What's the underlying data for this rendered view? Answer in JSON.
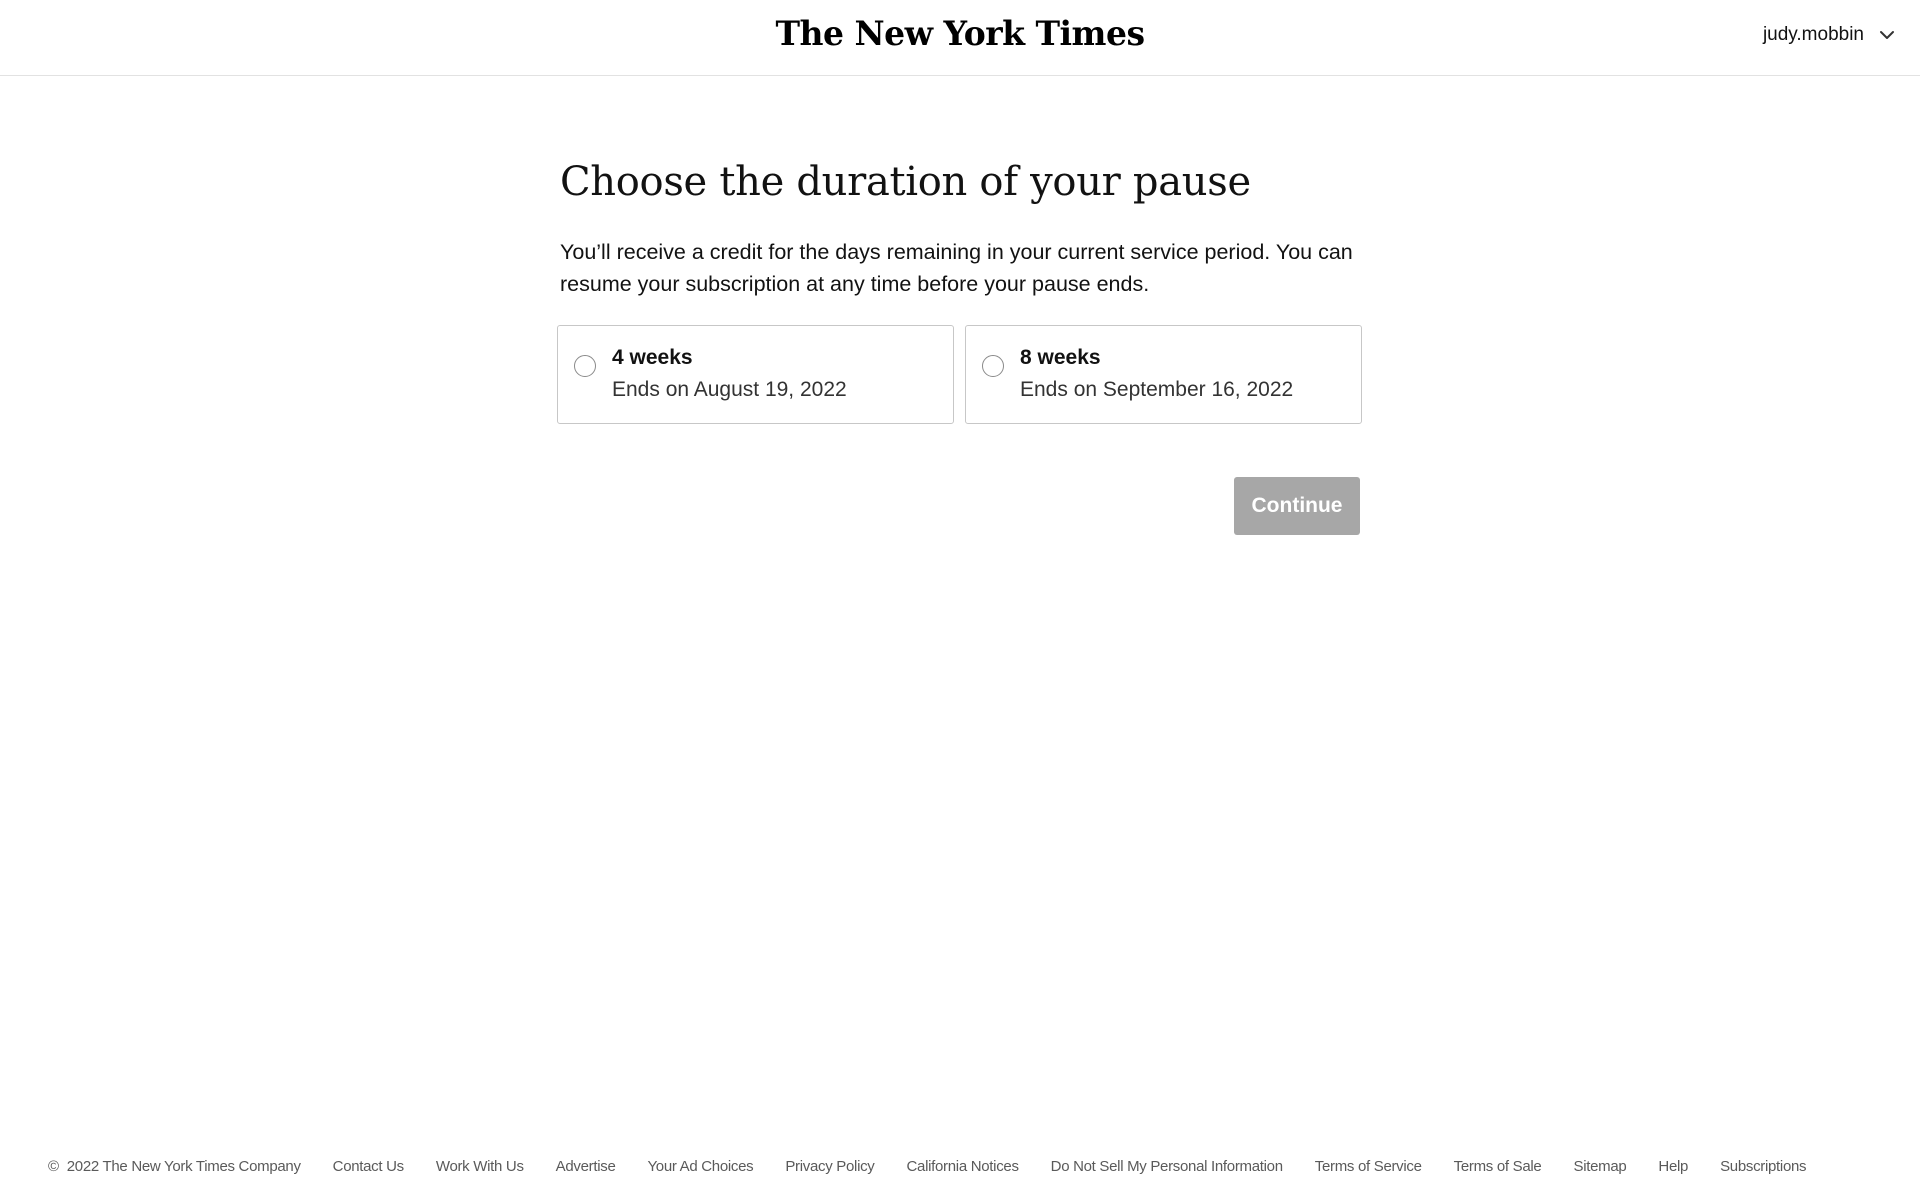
{
  "header": {
    "logo_text": "The New York Times",
    "account_name": "judy.mobbin",
    "account_icon": "chevron-down-icon"
  },
  "main": {
    "title": "Choose the duration of your pause",
    "description": "You’ll receive a credit for the days remaining in your current service period. You can resume your subscription at any time before your pause ends.",
    "options": [
      {
        "title": "4 weeks",
        "subtitle": "Ends on August 19, 2022",
        "selected": false
      },
      {
        "title": "8 weeks",
        "subtitle": "Ends on September 16, 2022",
        "selected": false
      }
    ],
    "continue_label": "Continue",
    "continue_color": "#a7a7a7"
  },
  "footer": {
    "copyright_symbol": "©",
    "copyright_text": "2022 The New York Times Company",
    "links": [
      "Contact Us",
      "Work With Us",
      "Advertise",
      "Your Ad Choices",
      "Privacy Policy",
      "California Notices",
      "Do Not Sell My Personal Information",
      "Terms of Service",
      "Terms of Sale",
      "Sitemap",
      "Help",
      "Subscriptions"
    ]
  }
}
